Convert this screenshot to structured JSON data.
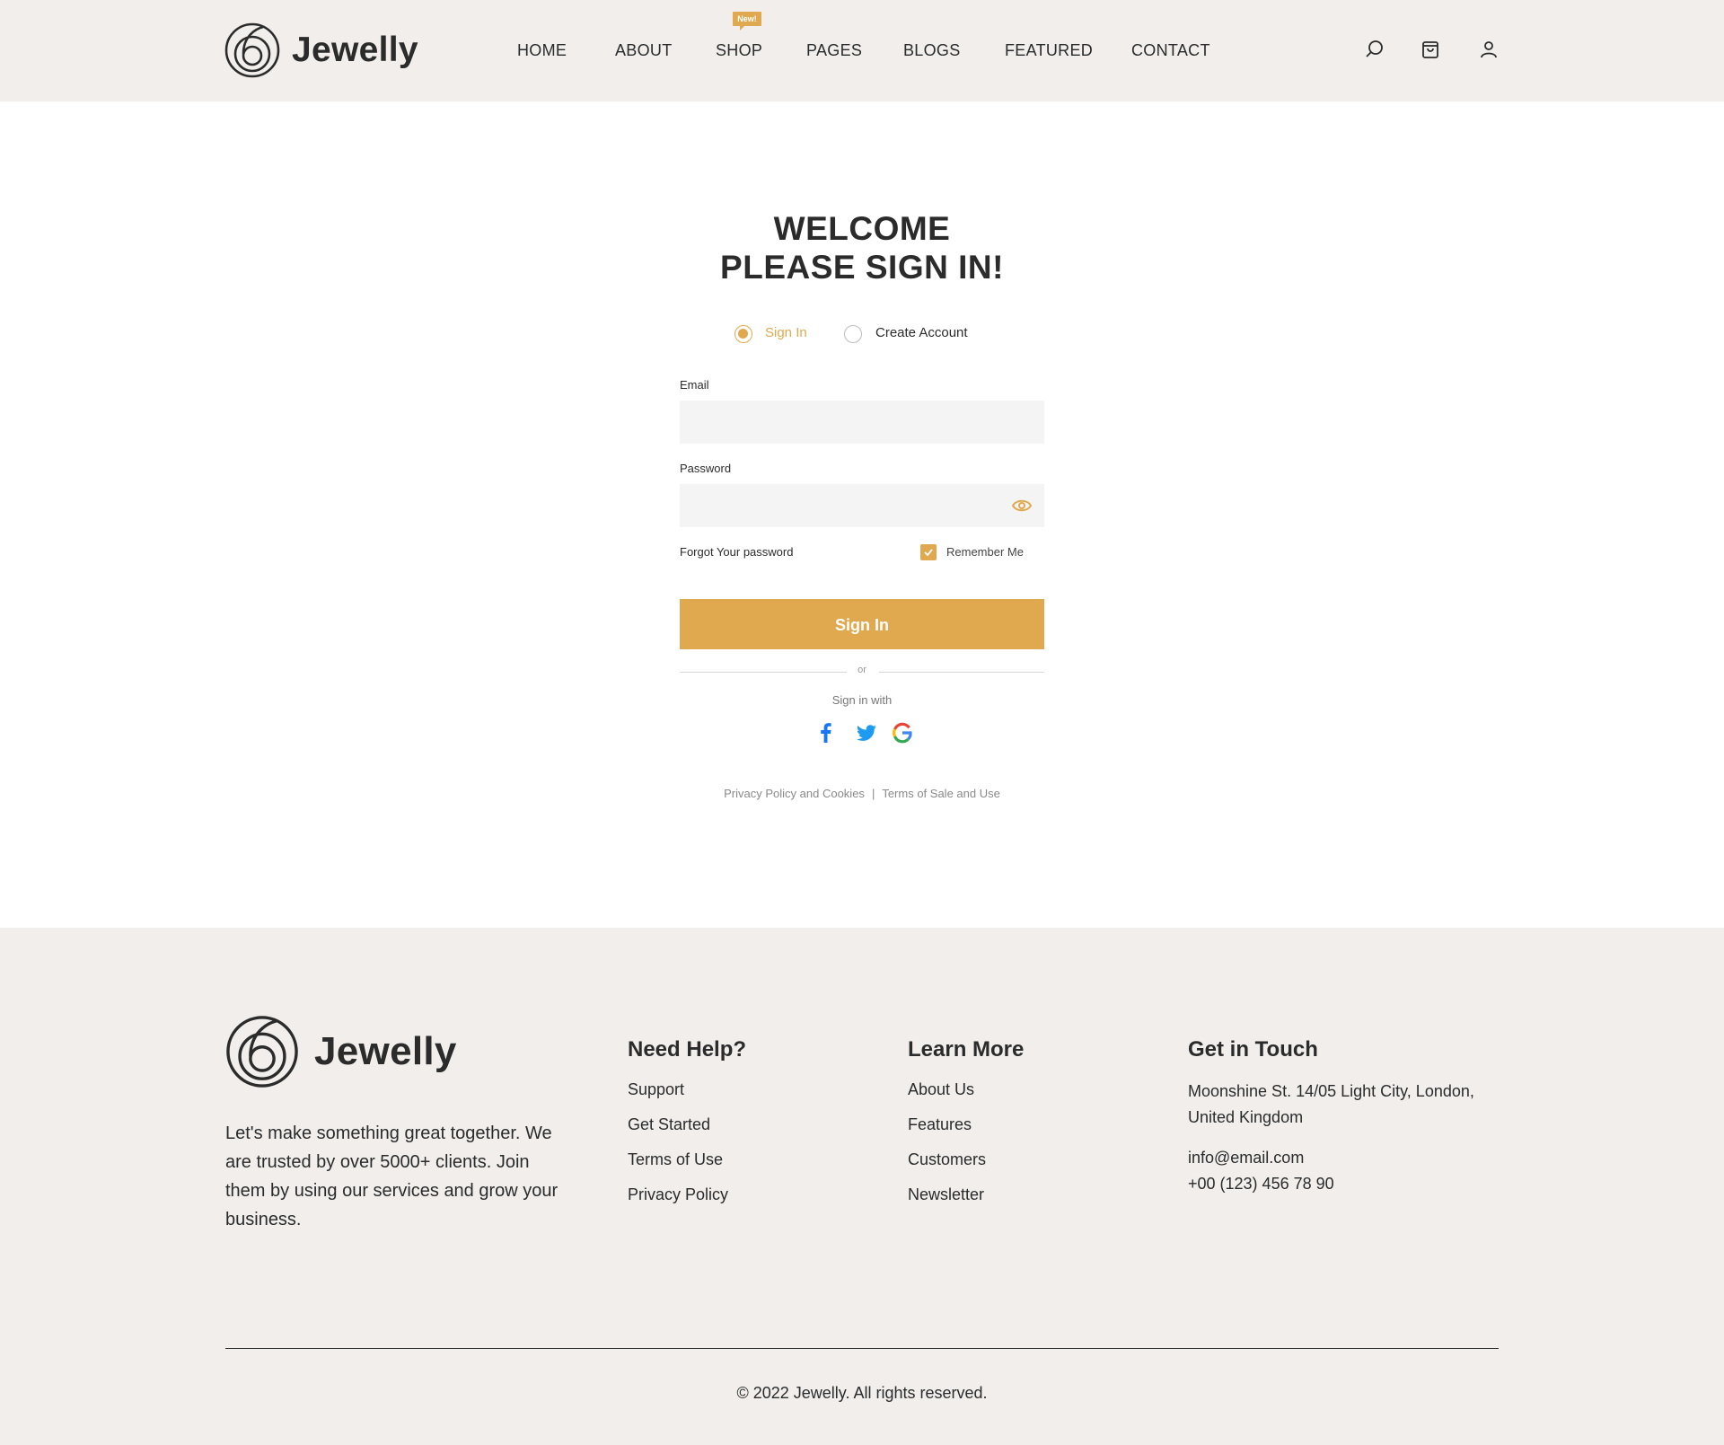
{
  "brand": {
    "name": "Jewelly",
    "accent_color": "#e0a94f",
    "bg_color": "#f1eeeb"
  },
  "nav": {
    "items": [
      {
        "label": "HOME"
      },
      {
        "label": "ABOUT"
      },
      {
        "label": "SHOP",
        "badge": "New!"
      },
      {
        "label": "PAGES"
      },
      {
        "label": "BLOGS"
      },
      {
        "label": "FEATURED"
      },
      {
        "label": "CONTACT"
      }
    ],
    "icons": [
      "search-icon",
      "shopping-bag-icon",
      "user-icon"
    ]
  },
  "signin": {
    "title_line1": "WELCOME",
    "title_line2": "PLEASE SIGN IN!",
    "mode_options": [
      {
        "label": "Sign In",
        "selected": true
      },
      {
        "label": "Create Account",
        "selected": false
      }
    ],
    "email_label": "Email",
    "email_value": "",
    "password_label": "Password",
    "password_value": "",
    "forgot_label": "Forgot Your password",
    "remember_label": "Remember Me",
    "remember_checked": true,
    "submit_label": "Sign In",
    "or_label": "or",
    "sign_in_with_label": "Sign in with",
    "social_icons": [
      "facebook-icon",
      "twitter-icon",
      "google-icon"
    ],
    "legal": {
      "privacy": "Privacy Policy and Cookies",
      "separator": "|",
      "terms": "Terms of Sale and Use"
    }
  },
  "footer": {
    "brand_name": "Jewelly",
    "description": "Let's make something great together. We are trusted by over 5000+ clients. Join them by using our services and grow your business.",
    "help": {
      "title": "Need Help?",
      "links": [
        "Support",
        "Get Started",
        "Terms of Use",
        "Privacy Policy"
      ]
    },
    "learn": {
      "title": "Learn More",
      "links": [
        "About Us",
        "Features",
        "Customers",
        "Newsletter"
      ]
    },
    "contact": {
      "title": "Get in Touch",
      "address_line1": "Moonshine St. 14/05 Light City, London,",
      "address_line2": "United Kingdom",
      "email": "info@email.com",
      "phone": "+00 (123) 456 78 90"
    },
    "copyright": "© 2022 Jewelly. All rights reserved."
  }
}
